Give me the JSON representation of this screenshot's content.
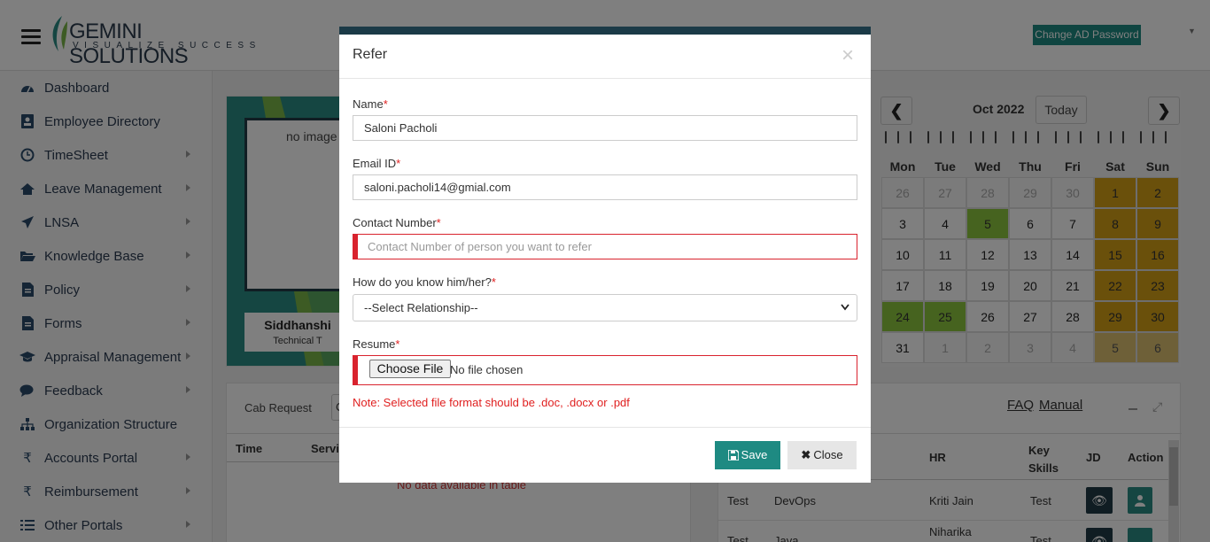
{
  "header": {
    "logo_brand": "GEMINI SOLUTIONS",
    "logo_tagline": "VISUALIZE SUCCESS",
    "change_ad_password": "Change AD Password"
  },
  "sidebar": {
    "items": [
      {
        "label": "Dashboard",
        "icon": "dashboard-icon",
        "has_submenu": false
      },
      {
        "label": "Employee Directory",
        "icon": "contact-card-icon",
        "has_submenu": false
      },
      {
        "label": "TimeSheet",
        "icon": "clock-icon",
        "has_submenu": true
      },
      {
        "label": "Leave Management",
        "icon": "home-icon",
        "has_submenu": true
      },
      {
        "label": "LNSA",
        "icon": "paper-plane-icon",
        "has_submenu": true
      },
      {
        "label": "Knowledge Base",
        "icon": "folder-open-icon",
        "has_submenu": true
      },
      {
        "label": "Policy",
        "icon": "document-icon",
        "has_submenu": true
      },
      {
        "label": "Forms",
        "icon": "file-icon",
        "has_submenu": true
      },
      {
        "label": "Appraisal Management",
        "icon": "graduation-cap-icon",
        "has_submenu": true
      },
      {
        "label": "Feedback",
        "icon": "comments-icon",
        "has_submenu": true
      },
      {
        "label": "Organization Structure",
        "icon": "sitemap-icon",
        "has_submenu": false
      },
      {
        "label": "Accounts Portal",
        "icon": "rupee-icon",
        "has_submenu": true
      },
      {
        "label": "Reimbursement",
        "icon": "rupee-icon",
        "has_submenu": true
      },
      {
        "label": "Other Portals",
        "icon": "list-icon",
        "has_submenu": true
      }
    ]
  },
  "profile": {
    "image_alt": "no image",
    "name": "Siddhanshi",
    "role": "Technical T"
  },
  "cab": {
    "label": "Cab Request",
    "select_value": "C",
    "col_time": "Time",
    "col_service": "Servic",
    "no_data": "No data available in table"
  },
  "calendar": {
    "prev": "❮",
    "next": "❯",
    "month": "Oct 2022",
    "today": "Today",
    "days": [
      "Mon",
      "Tue",
      "Wed",
      "Thu",
      "Fri",
      "Sat",
      "Sun"
    ],
    "weeks": [
      [
        {
          "d": "26",
          "t": "o"
        },
        {
          "d": "27",
          "t": "o"
        },
        {
          "d": "28",
          "t": "o"
        },
        {
          "d": "29",
          "t": "o"
        },
        {
          "d": "30",
          "t": "o"
        },
        {
          "d": "1",
          "t": "w"
        },
        {
          "d": "2",
          "t": "w"
        }
      ],
      [
        {
          "d": "3",
          "t": "n"
        },
        {
          "d": "4",
          "t": "n"
        },
        {
          "d": "5",
          "t": "g"
        },
        {
          "d": "6",
          "t": "n"
        },
        {
          "d": "7",
          "t": "n"
        },
        {
          "d": "8",
          "t": "w"
        },
        {
          "d": "9",
          "t": "w"
        }
      ],
      [
        {
          "d": "10",
          "t": "n"
        },
        {
          "d": "11",
          "t": "n"
        },
        {
          "d": "12",
          "t": "n"
        },
        {
          "d": "13",
          "t": "n"
        },
        {
          "d": "14",
          "t": "n"
        },
        {
          "d": "15",
          "t": "w"
        },
        {
          "d": "16",
          "t": "w"
        }
      ],
      [
        {
          "d": "17",
          "t": "n"
        },
        {
          "d": "18",
          "t": "n"
        },
        {
          "d": "19",
          "t": "n"
        },
        {
          "d": "20",
          "t": "n"
        },
        {
          "d": "21",
          "t": "n"
        },
        {
          "d": "22",
          "t": "w"
        },
        {
          "d": "23",
          "t": "w"
        }
      ],
      [
        {
          "d": "24",
          "t": "g"
        },
        {
          "d": "25",
          "t": "g"
        },
        {
          "d": "26",
          "t": "n"
        },
        {
          "d": "27",
          "t": "n"
        },
        {
          "d": "28",
          "t": "n"
        },
        {
          "d": "29",
          "t": "w"
        },
        {
          "d": "30",
          "t": "w"
        }
      ],
      [
        {
          "d": "31",
          "t": "n"
        },
        {
          "d": "1",
          "t": "o"
        },
        {
          "d": "2",
          "t": "o"
        },
        {
          "d": "3",
          "t": "o"
        },
        {
          "d": "4",
          "t": "o"
        },
        {
          "d": "5",
          "t": "wo"
        },
        {
          "d": "6",
          "t": "wo"
        }
      ]
    ]
  },
  "faq": {
    "faq_label": "FAQ",
    "manual_label": "Manual",
    "headers": {
      "hr": "HR",
      "key_skills": "Key Skills",
      "jd": "JD",
      "action": "Action"
    },
    "rows": [
      {
        "col1": "Test",
        "col2": "DevOps",
        "hr": "Kriti Jain",
        "skills": "Test"
      },
      {
        "col1": "Test",
        "col2": "Java",
        "hr": "Niharika",
        "skills": "Test"
      }
    ]
  },
  "modal": {
    "title": "Refer",
    "close_x": "×",
    "name_label": "Name",
    "name_value": "Saloni Pacholi",
    "email_label": "Email ID",
    "email_value": "saloni.pacholi14@gmial.com",
    "contact_label": "Contact Number",
    "contact_placeholder": "Contact Number of person you want to refer",
    "relation_label": "How do you know him/her?",
    "relation_value": "--Select Relationship--",
    "resume_label": "Resume",
    "file_button": "Choose File",
    "file_status": "No file chosen",
    "note": "Note: Selected file format should be .doc, .docx or .pdf",
    "save_label": "Save",
    "close_label": "Close",
    "required_mark": "*"
  },
  "colors": {
    "teal": "#1e8a82",
    "navy": "#1b3a47",
    "weekend": "#d4a017",
    "holiday_green": "#8cc63f",
    "error": "#d9232e"
  }
}
